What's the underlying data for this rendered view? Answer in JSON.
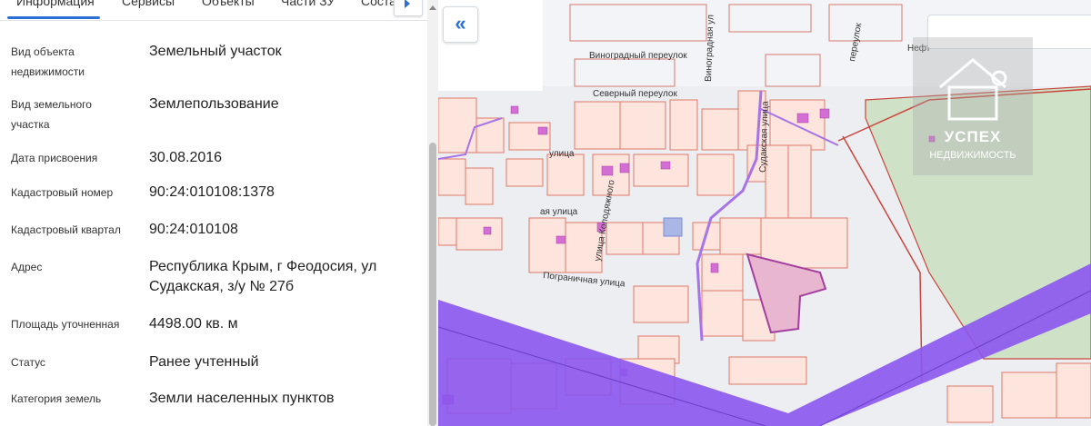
{
  "tabs": [
    {
      "label": "Информация"
    },
    {
      "label": "Сервисы"
    },
    {
      "label": "Объекты"
    },
    {
      "label": "Части ЗУ"
    },
    {
      "label": "Соста"
    }
  ],
  "info": {
    "rows": [
      {
        "label": "Вид объекта недвижимости",
        "value": "Земельный участок"
      },
      {
        "label": "Вид земельного участка",
        "value": "Землепользование"
      },
      {
        "label": "Дата присвоения",
        "value": "30.08.2016"
      },
      {
        "label": "Кадастровый номер",
        "value": "90:24:010108:1378"
      },
      {
        "label": "Кадастровый квартал",
        "value": "90:24:010108"
      },
      {
        "label": "Адрес",
        "value": "Республика Крым, г Феодосия, ул Судакская, з/у № 27б"
      },
      {
        "label": "Площадь уточненная",
        "value": "4498.00 кв. м"
      },
      {
        "label": "Статус",
        "value": "Ранее учтенный"
      },
      {
        "label": "Категория земель",
        "value": "Земли населенных пунктов"
      }
    ]
  },
  "map": {
    "collapse_icon": "double-chevron-left-icon",
    "streets": {
      "vinogradny": "Виноградный переулок",
      "severny": "Северный переулок",
      "vinogradnaya": "Виноградная ул",
      "sudakskaya": "Судакская улица",
      "kolodyazhnogo": "улица Колодяжного",
      "pogranichnaya": "Пограничная улица",
      "ulitsa1": "улица",
      "ulitsa2": "ая улица",
      "pereulok": "переулок",
      "neft": "Нефт"
    },
    "watermark": {
      "title": "УСПЕХ",
      "subtitle": "НЕДВИЖИМОСТЬ"
    },
    "colors": {
      "parcel_fill": "#fde4dc",
      "parcel_stroke": "#e07a6a",
      "selected_fill": "#e8b6cf",
      "selected_stroke": "#a43fa0",
      "corridor": "#8b55ee",
      "green_zone": "#cfe2c8"
    }
  }
}
